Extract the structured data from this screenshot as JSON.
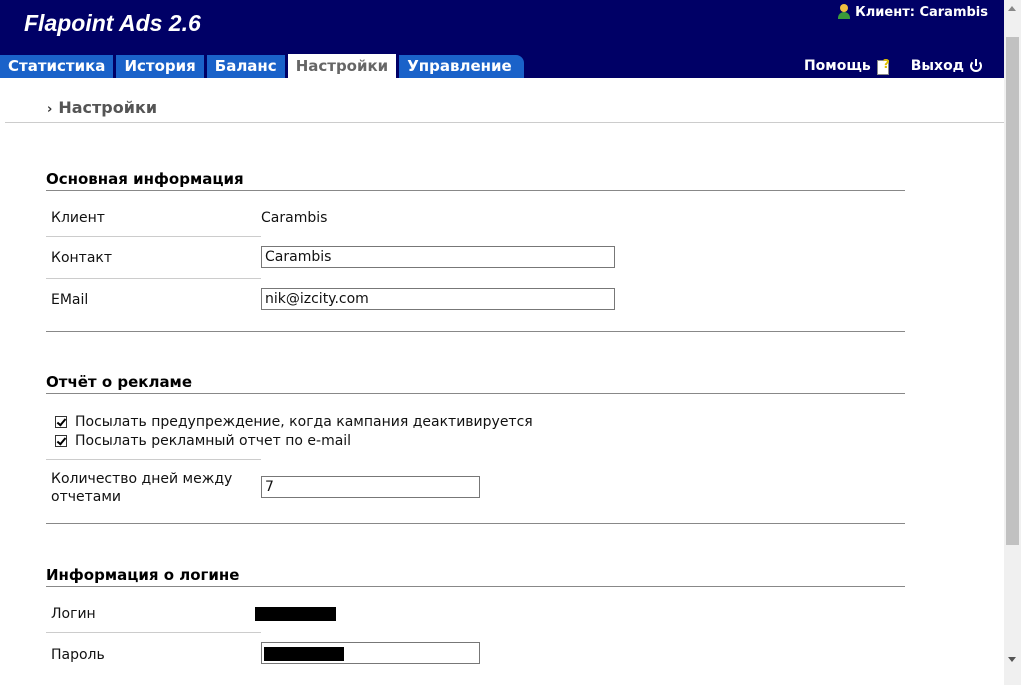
{
  "app": {
    "title": "Flapoint Ads 2.6"
  },
  "header": {
    "client_label": "Клиент: Carambis",
    "help_label": "Помощь",
    "logout_label": "Выход"
  },
  "tabs": [
    {
      "label": "Статистика"
    },
    {
      "label": "История"
    },
    {
      "label": "Баланс"
    },
    {
      "label": "Настройки",
      "active": true
    },
    {
      "label": "Управление"
    }
  ],
  "breadcrumb": {
    "label": "Настройки"
  },
  "basic_info": {
    "title": "Основная информация",
    "client_label": "Клиент",
    "client_value": "Carambis",
    "contact_label": "Контакт",
    "contact_value": "Carambis",
    "email_label": "EMail",
    "email_value": "nik@izcity.com"
  },
  "report": {
    "title": "Отчёт о рекламе",
    "check_warn_label": "Посылать предупреждение, когда кампания деактивируется",
    "check_report_label": "Посылать рекламный отчет по e-mail",
    "days_label_line1": "Количество дней между",
    "days_label_line2": "отчетами",
    "days_value": "7"
  },
  "login": {
    "title": "Информация о логине",
    "login_label": "Логин",
    "password_label": "Пароль"
  },
  "colors": {
    "header_bg": "#000066",
    "tab_bg": "#1a62c9",
    "tab_active_text": "#666666"
  }
}
